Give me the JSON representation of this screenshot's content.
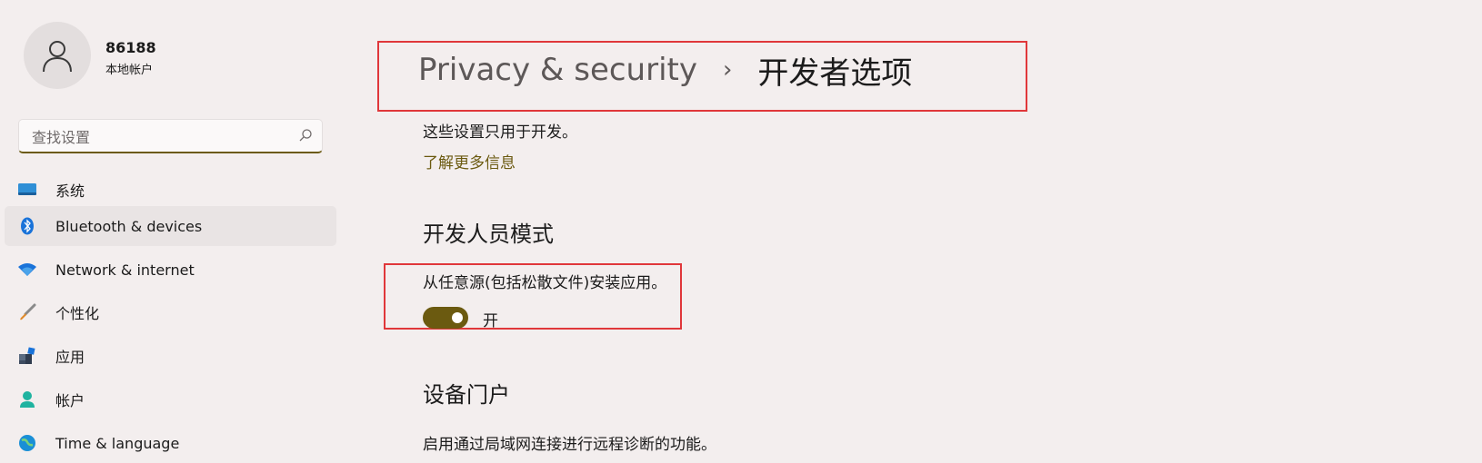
{
  "user": {
    "name": "86188",
    "account_type": "本地帐户"
  },
  "search": {
    "placeholder": "查找设置"
  },
  "nav": {
    "items": [
      {
        "label": "系统",
        "icon": "system-icon"
      },
      {
        "label": "Bluetooth & devices",
        "icon": "bluetooth-icon",
        "active": true
      },
      {
        "label": "Network & internet",
        "icon": "wifi-icon"
      },
      {
        "label": "个性化",
        "icon": "brush-icon"
      },
      {
        "label": "应用",
        "icon": "apps-icon"
      },
      {
        "label": "帐户",
        "icon": "account-icon"
      },
      {
        "label": "Time & language",
        "icon": "globe-icon"
      }
    ]
  },
  "breadcrumb": {
    "parent": "Privacy & security",
    "separator": "›",
    "current": "开发者选项"
  },
  "content": {
    "description": "这些设置只用于开发。",
    "learn_more": "了解更多信息",
    "developer_mode": {
      "title": "开发人员模式",
      "description": "从任意源(包括松散文件)安装应用。",
      "toggle_state": "开",
      "enabled": true
    },
    "device_portal": {
      "title": "设备门户",
      "description": "启用通过局域网连接进行远程诊断的功能。"
    }
  },
  "colors": {
    "accent": "#6b5a10",
    "annotation": "#e0373a",
    "background": "#f3eeee"
  }
}
